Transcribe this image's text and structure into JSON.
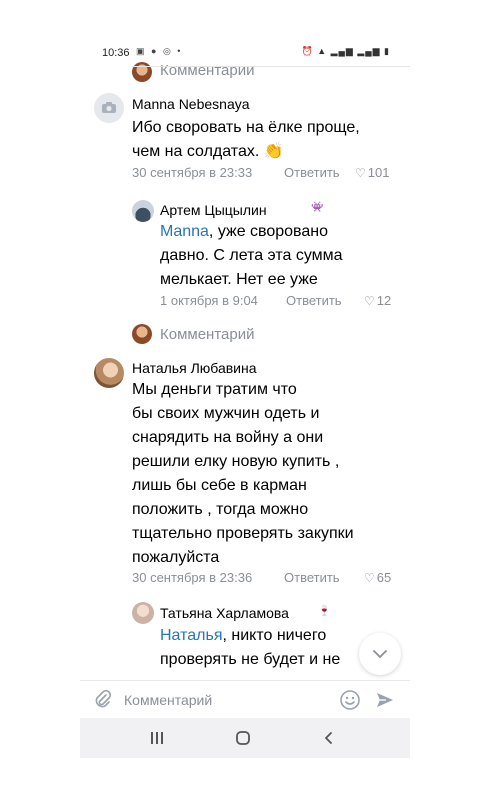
{
  "status_bar": {
    "time": "10:36"
  },
  "comments": [
    {
      "sub_comments_label": "Комментарии"
    },
    {
      "author": "Manna Nebesnaya",
      "lines": [
        "Ибо своровать на ёлке проще,",
        "чем на солдатах. 👏"
      ],
      "date": "30 сентября в 23:33",
      "reply_label": "Ответить",
      "likes": "101"
    },
    {
      "author": "Артем Цыцылин",
      "mention": "Manna",
      "lines": [
        ", уже своровано",
        "давно. С лета эта сумма",
        "мелькает. Нет ее уже"
      ],
      "date": "1 октября в 9:04",
      "reply_label": "Ответить",
      "likes": "12",
      "sub_comments_label": "Комментарий"
    },
    {
      "author": "Наталья Любавина",
      "lines": [
        "Мы деньги тратим что",
        "бы своих мужчин одеть и",
        "снарядить на войну а они",
        "решили елку новую купить ,",
        "лишь бы себе в карман",
        "положить , тогда можно",
        "тщательно проверять закупки",
        "пожалуйста"
      ],
      "date": "30 сентября в 23:36",
      "reply_label": "Ответить",
      "likes": "65"
    },
    {
      "author": "Татьяна Харламова",
      "mention": "Наталья",
      "lines": [
        ", никто ничего",
        "проверять не будет и не"
      ]
    }
  ],
  "composer": {
    "placeholder": "Комментарий"
  },
  "icons": {
    "clip": "paperclip-icon",
    "emoji": "smiley-icon",
    "send": "send-icon",
    "scroll_down": "chevron-down-icon",
    "nav_recent": "recent-apps-icon",
    "nav_home": "home-icon",
    "nav_back": "back-icon"
  },
  "colors": {
    "link": "#2a74b8",
    "meta": "#8a8f96",
    "nav_bg": "#f1f1f3"
  }
}
